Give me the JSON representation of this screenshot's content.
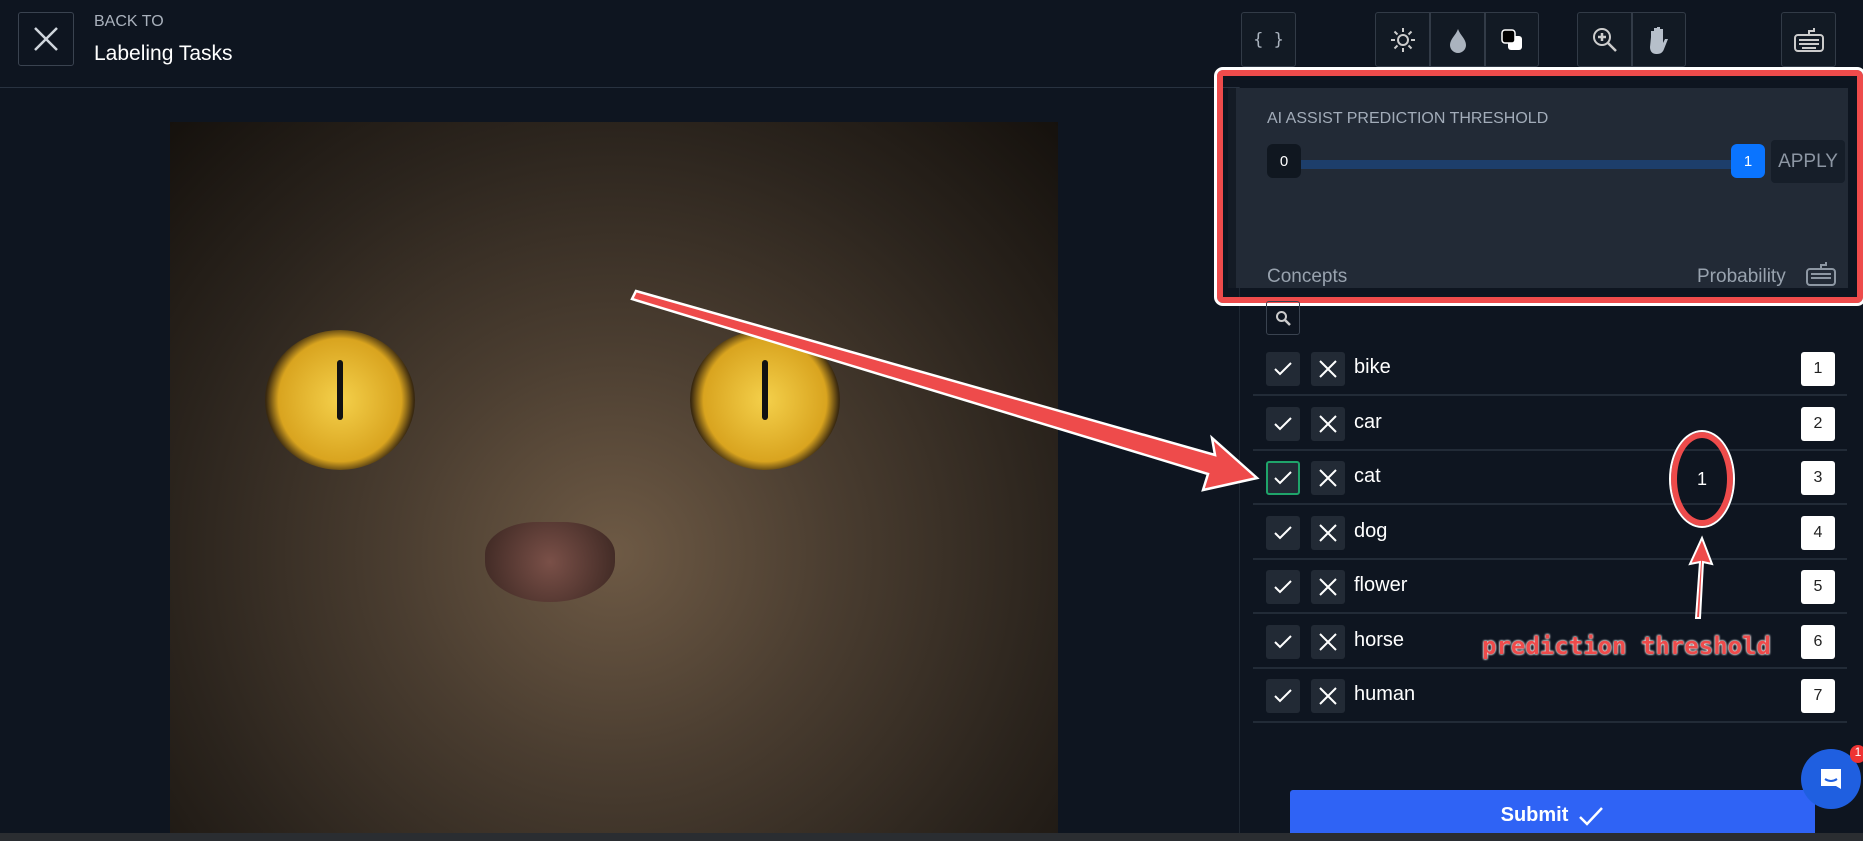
{
  "header": {
    "back_to": "BACK TO",
    "title": "Labeling Tasks"
  },
  "toolbar": {
    "icons": [
      "code-braces-icon",
      "brightness-icon",
      "saturation-icon",
      "invert-icon",
      "zoom-in-icon",
      "hand-pan-icon",
      "keyboard-icon"
    ]
  },
  "threshold": {
    "label": "AI ASSIST PREDICTION THRESHOLD",
    "min": "0",
    "max": "1",
    "apply": "APPLY",
    "accent": "#0a74ff"
  },
  "concepts": {
    "header": "Concepts",
    "probability_header": "Probability",
    "items": [
      {
        "label": "bike",
        "hotkey": "1"
      },
      {
        "label": "car",
        "hotkey": "2"
      },
      {
        "label": "cat",
        "hotkey": "3",
        "probability": "1",
        "selected": true
      },
      {
        "label": "dog",
        "hotkey": "4"
      },
      {
        "label": "flower",
        "hotkey": "5"
      },
      {
        "label": "horse",
        "hotkey": "6"
      },
      {
        "label": "human",
        "hotkey": "7"
      }
    ]
  },
  "submit": {
    "label": "Submit"
  },
  "chat": {
    "badge": "1"
  },
  "annotation": {
    "text": "prediction threshold",
    "color": "#ee4b4b"
  }
}
